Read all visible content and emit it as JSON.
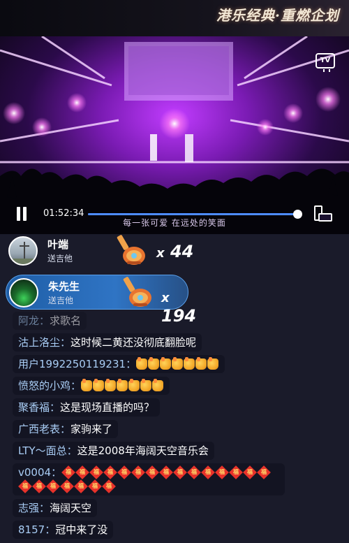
{
  "banner": {
    "title": "港乐经典·重燃企划"
  },
  "player": {
    "time": "01:52:34",
    "progress": 0.98,
    "subtitle": "每一张可爱 在远处的笑面",
    "tv_label": "TV"
  },
  "gifts": [
    {
      "name": "叶端",
      "action": "送吉他",
      "count": "44"
    },
    {
      "name": "朱先生",
      "action": "送吉他",
      "count": "194"
    }
  ],
  "count_prefix": "x",
  "comments": [
    {
      "user": "阿龙",
      "text": "求歌名"
    },
    {
      "user": "沽上洛尘",
      "text": "这时候二黄还没彻底翻脸呢"
    },
    {
      "user": "用户1992250119231",
      "text": "",
      "thumbs": 7
    },
    {
      "user": "愤怒的小鸡",
      "text": "",
      "thumbs": 7
    },
    {
      "user": "聚香福",
      "text": "这是现场直播的吗？"
    },
    {
      "user": "广西老表",
      "text": "家驹来了"
    },
    {
      "user": "LTY～面总",
      "text": "这是2008年海阔天空音乐会"
    },
    {
      "user": "v0004",
      "text": "",
      "fu": 22,
      "fu_char": "福"
    },
    {
      "user": "志强",
      "text": "海阔天空"
    },
    {
      "user": "8157",
      "text": "冠中来了没"
    }
  ],
  "colors": {
    "highlight": "#2f74c4",
    "progress": "#4e8cff",
    "username": "#a9cdf5"
  }
}
